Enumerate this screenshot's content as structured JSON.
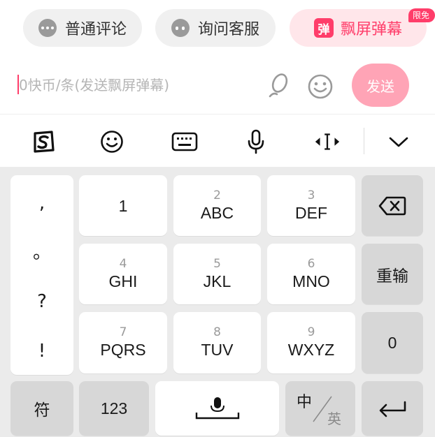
{
  "tabs": {
    "normal_label": "普通评论",
    "service_label": "询问客服",
    "danmaku_label": "飘屏弹幕",
    "danmaku_icon_text": "弹",
    "badge": "限免"
  },
  "input": {
    "placeholder": "0快币/条(发送飘屏弹幕)",
    "send_label": "发送"
  },
  "toolbar": {
    "icons": [
      "sogou-logo-icon",
      "emoji-icon",
      "keyboard-icon",
      "mic-icon",
      "cursor-move-icon",
      "collapse-chevron-icon"
    ]
  },
  "keyboard": {
    "punct": [
      ",",
      "。",
      "?",
      "!"
    ],
    "keys": {
      "k1": {
        "num": "",
        "main": "1"
      },
      "k2": {
        "num": "2",
        "main": "ABC"
      },
      "k3": {
        "num": "3",
        "main": "DEF"
      },
      "k4": {
        "num": "4",
        "main": "GHI"
      },
      "k5": {
        "num": "5",
        "main": "JKL"
      },
      "k6": {
        "num": "6",
        "main": "MNO"
      },
      "k7": {
        "num": "7",
        "main": "PQRS"
      },
      "k8": {
        "num": "8",
        "main": "TUV"
      },
      "k9": {
        "num": "9",
        "main": "WXYZ"
      }
    },
    "reinput": "重输",
    "zero": "0",
    "symbols": "符",
    "numbers": "123",
    "lang_cn": "中",
    "lang_en": "英"
  },
  "colors": {
    "accent": "#ff3d6a",
    "send_disabled": "#ffa4b6",
    "keyboard_bg": "#ebebeb",
    "key_gray": "#d7d7d7"
  }
}
